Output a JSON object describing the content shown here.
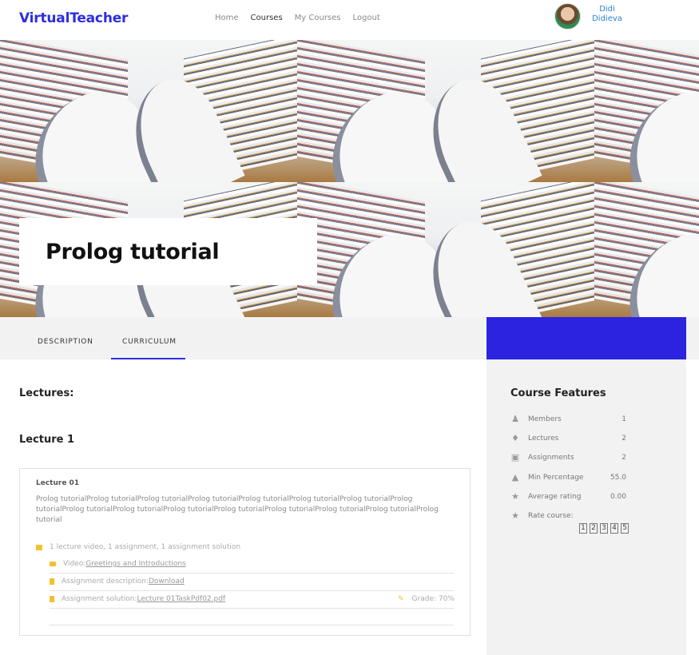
{
  "header": {
    "brand": "VirtualTeacher",
    "nav": [
      "Home",
      "Courses",
      "My Courses",
      "Logout"
    ],
    "active_nav": "Courses",
    "user_first": "Didi",
    "user_last": "Didieva"
  },
  "banner": {
    "title": "Prolog tutorial"
  },
  "tabs": [
    "DESCRIPTION",
    "CURRICULUM"
  ],
  "active_tab": "CURRICULUM",
  "main": {
    "lectures_heading": "Lectures:",
    "lecture_group": "Lecture 1",
    "card": {
      "title": "Lecture 01",
      "description": "Prolog tutorialProlog tutorialProlog tutorialProlog tutorialProlog tutorialProlog tutorialProlog tutorialProlog tutorialProlog tutorialProlog tutorialProlog tutorialProlog tutorialProlog tutorialProlog tutorialProlog tutorialProlog tutorial",
      "summary": "1 lecture video, 1 assignment, 1 assignment solution",
      "video_label": "Video: ",
      "video_link": "Greetings and Introductions",
      "assign_desc_label": "Assignment description: ",
      "assign_desc_link": "Download",
      "assign_sol_label": "Assignment solution:",
      "assign_sol_link": "Lecture 01TaskPdf02.pdf",
      "grade": "Grade: 70%"
    }
  },
  "sidebar": {
    "title": "Course Features",
    "features": [
      {
        "icon": "users-icon",
        "label": "Members",
        "value": "1"
      },
      {
        "icon": "bell-icon",
        "label": "Lectures",
        "value": "2"
      },
      {
        "icon": "clipboard-icon",
        "label": "Assignments",
        "value": "2"
      },
      {
        "icon": "thumbs-up-icon",
        "label": "Min Percentage",
        "value": "55.0"
      },
      {
        "icon": "star-icon",
        "label": "Average rating",
        "value": "0.00"
      },
      {
        "icon": "star-icon",
        "label": "Rate course:",
        "value": ""
      }
    ],
    "rate_options": [
      "1",
      "2",
      "3",
      "4",
      "5"
    ]
  },
  "colors": {
    "brand": "#2b2ee0",
    "accent_block": "#2b23df",
    "file_icon": "#f2c12e",
    "sidebar_bg": "#f2f2f2"
  }
}
